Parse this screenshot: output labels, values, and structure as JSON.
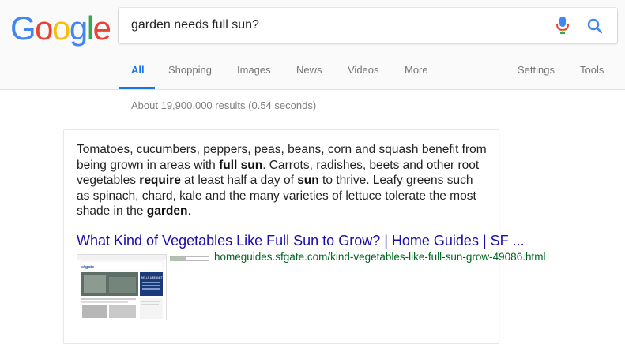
{
  "logo": {
    "letters": [
      "G",
      "o",
      "o",
      "g",
      "l",
      "e"
    ],
    "colors": [
      "#4285F4",
      "#EA4335",
      "#FBBC05",
      "#4285F4",
      "#34A853",
      "#EA4335"
    ]
  },
  "search": {
    "query": "garden needs full sun?"
  },
  "tabs": [
    {
      "label": "All",
      "active": true
    },
    {
      "label": "Shopping"
    },
    {
      "label": "Images"
    },
    {
      "label": "News"
    },
    {
      "label": "Videos"
    },
    {
      "label": "More"
    },
    {
      "label": "Settings"
    },
    {
      "label": "Tools"
    }
  ],
  "stats": "About 19,900,000 results (0.54 seconds)",
  "snippet": {
    "parts": [
      {
        "t": "Tomatoes, cucumbers, peppers, peas, beans, corn and squash benefit from being grown in areas with "
      },
      {
        "t": "full sun",
        "b": true
      },
      {
        "t": ". Carrots, radishes, beets and other root vegetables "
      },
      {
        "t": "require",
        "b": true
      },
      {
        "t": " at least half a day of "
      },
      {
        "t": "sun",
        "b": true
      },
      {
        "t": " to thrive. Leafy greens such as spinach, chard, kale and the many varieties of lettuce tolerate the most shade in the "
      },
      {
        "t": "garden",
        "b": true
      },
      {
        "t": "."
      }
    ]
  },
  "result": {
    "title": "What Kind of Vegetables Like Full Sun to Grow? | Home Guides | SF ...",
    "url": "homeguides.sfgate.com/kind-vegetables-like-full-sun-grow-49086.html",
    "thumb_site": "sfgate",
    "thumb_banner": "WELLS & BENNETT",
    "thumb_progress": 0.4
  },
  "colors": {
    "accent": "#1a73e8",
    "link": "#1a0dab",
    "url": "#006621"
  }
}
